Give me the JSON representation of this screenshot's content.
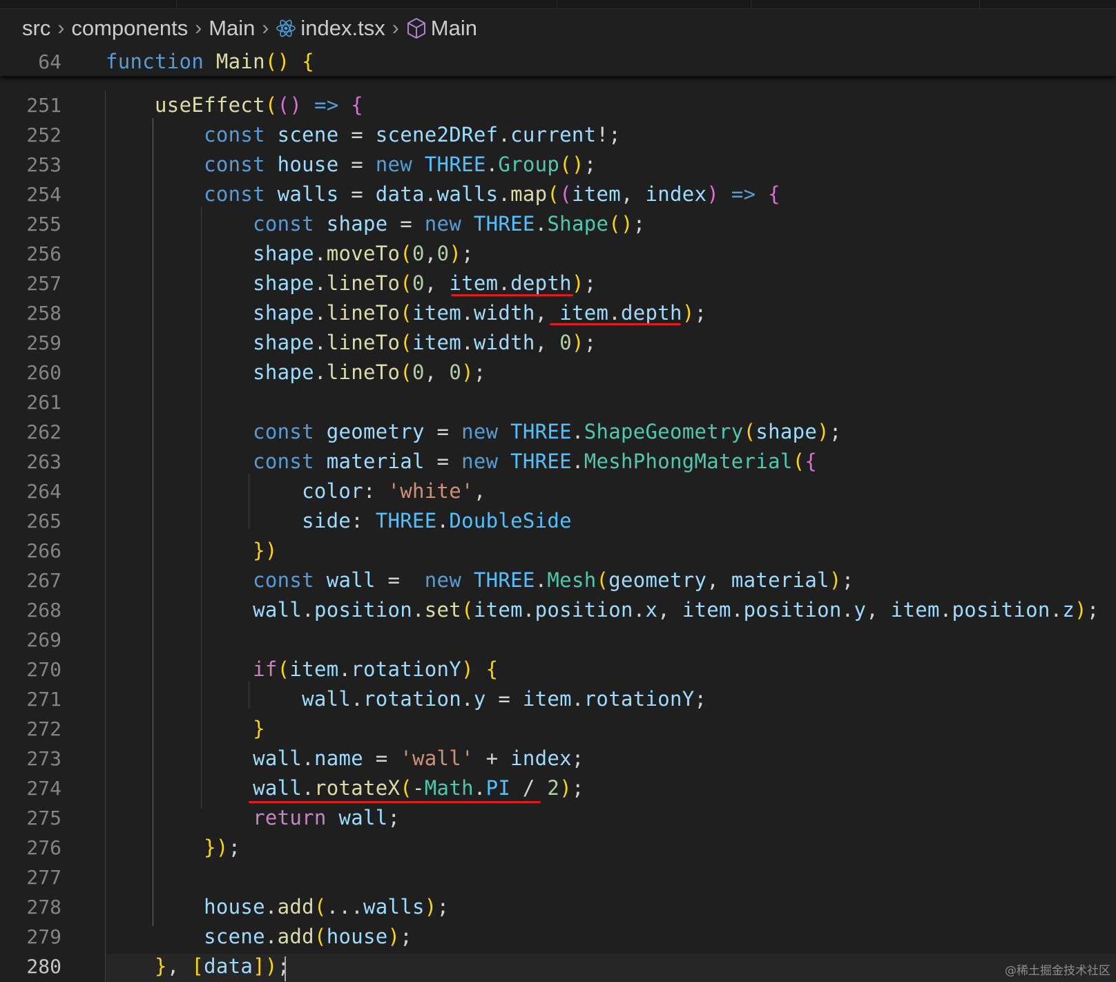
{
  "breadcrumb": {
    "items": [
      "src",
      "components",
      "Main",
      "index.tsx",
      "Main"
    ],
    "icons": {
      "file": "react-icon",
      "symbol": "cube-icon"
    }
  },
  "sticky_line": {
    "number": "64",
    "code": "function Main() {"
  },
  "lines": [
    {
      "n": "251",
      "code": "    useEffect(() => {"
    },
    {
      "n": "252",
      "code": "        const scene = scene2DRef.current!;"
    },
    {
      "n": "253",
      "code": "        const house = new THREE.Group();"
    },
    {
      "n": "254",
      "code": "        const walls = data.walls.map((item, index) => {"
    },
    {
      "n": "255",
      "code": "            const shape = new THREE.Shape();"
    },
    {
      "n": "256",
      "code": "            shape.moveTo(0,0);"
    },
    {
      "n": "257",
      "code": "            shape.lineTo(0, item.depth);"
    },
    {
      "n": "258",
      "code": "            shape.lineTo(item.width, item.depth);"
    },
    {
      "n": "259",
      "code": "            shape.lineTo(item.width, 0);"
    },
    {
      "n": "260",
      "code": "            shape.lineTo(0, 0);"
    },
    {
      "n": "261",
      "code": ""
    },
    {
      "n": "262",
      "code": "            const geometry = new THREE.ShapeGeometry(shape);"
    },
    {
      "n": "263",
      "code": "            const material = new THREE.MeshPhongMaterial({"
    },
    {
      "n": "264",
      "code": "                color: 'white',"
    },
    {
      "n": "265",
      "code": "                side: THREE.DoubleSide"
    },
    {
      "n": "266",
      "code": "            })"
    },
    {
      "n": "267",
      "code": "            const wall =  new THREE.Mesh(geometry, material);"
    },
    {
      "n": "268",
      "code": "            wall.position.set(item.position.x, item.position.y, item.position.z);"
    },
    {
      "n": "269",
      "code": ""
    },
    {
      "n": "270",
      "code": "            if(item.rotationY) {"
    },
    {
      "n": "271",
      "code": "                wall.rotation.y = item.rotationY;"
    },
    {
      "n": "272",
      "code": "            }"
    },
    {
      "n": "273",
      "code": "            wall.name = 'wall' + index;"
    },
    {
      "n": "274",
      "code": "            wall.rotateX(-Math.PI / 2);"
    },
    {
      "n": "275",
      "code": "            return wall;"
    },
    {
      "n": "276",
      "code": "        });"
    },
    {
      "n": "277",
      "code": ""
    },
    {
      "n": "278",
      "code": "        house.add(...walls);"
    },
    {
      "n": "279",
      "code": "        scene.add(house);"
    },
    {
      "n": "280",
      "code": "    }, [data]);"
    }
  ],
  "current_line": "280",
  "watermark": "@稀土掘金技术社区",
  "colors": {
    "background": "#1f1f1f",
    "keyword": "#569cd6",
    "function": "#dcdcaa",
    "variable": "#9cdcfe",
    "constant": "#4fc1ff",
    "class": "#4ec9b0",
    "number": "#b5cea8",
    "string": "#ce9178",
    "control": "#c586c0",
    "annotation_underline": "#e01b1b"
  }
}
